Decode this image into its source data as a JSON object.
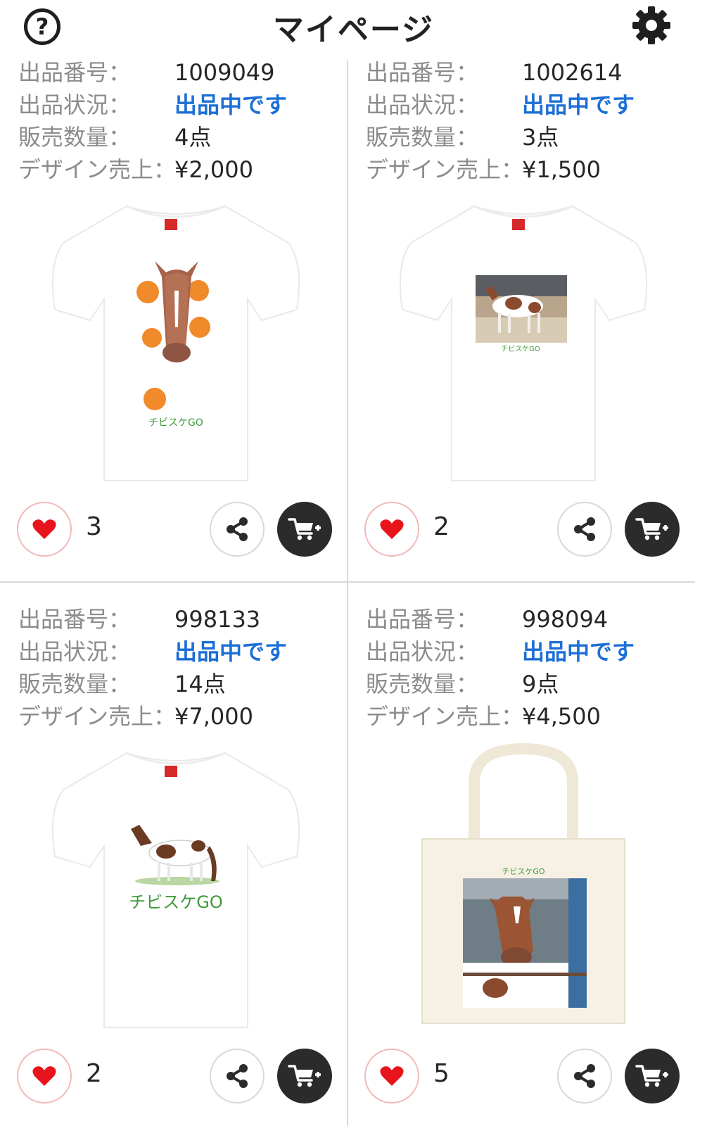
{
  "header": {
    "title": "マイページ",
    "help_label": "?",
    "help_icon": "question-circle-icon",
    "settings_icon": "gear-icon"
  },
  "labels": {
    "listing_number": "出品番号：",
    "listing_status": "出品状況：",
    "sales_quantity": "販売数量：",
    "design_sales": "デザイン売上："
  },
  "colors": {
    "status_blue": "#1c6fd6",
    "heart_red": "#e8141c",
    "cart_dark": "#2b2b2b",
    "brand_green": "#3e9a3a"
  },
  "products": [
    {
      "number": "1009049",
      "status": "出品中です",
      "quantity": "4点",
      "sales": "¥2,000",
      "likes": "3",
      "item": "t-shirt",
      "design_text": "チビスケGO"
    },
    {
      "number": "1002614",
      "status": "出品中です",
      "quantity": "3点",
      "sales": "¥1,500",
      "likes": "2",
      "item": "t-shirt",
      "design_text": "チビスケGO"
    },
    {
      "number": "998133",
      "status": "出品中です",
      "quantity": "14点",
      "sales": "¥7,000",
      "likes": "2",
      "item": "t-shirt",
      "design_text": "チビスケGO"
    },
    {
      "number": "998094",
      "status": "出品中です",
      "quantity": "9点",
      "sales": "¥4,500",
      "likes": "5",
      "item": "tote-bag",
      "design_text": "チビスケGO"
    }
  ]
}
